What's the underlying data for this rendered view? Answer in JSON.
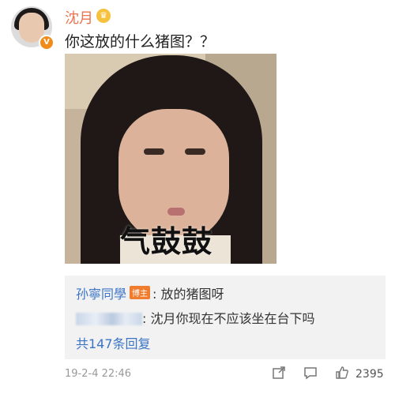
{
  "post": {
    "username": "沈月",
    "text": "你这放的什么猪图？？",
    "image": {
      "caption": "气鼓鼓"
    }
  },
  "comments": {
    "items": [
      {
        "user": "孙寧同學",
        "badge": "博主",
        "text": ": 放的猪图呀"
      },
      {
        "user_blurred": true,
        "text": ": 沈月你现在不应该坐在台下吗"
      }
    ],
    "more_replies": "共147条回复"
  },
  "footer": {
    "timestamp": "19-2-4 22:46",
    "like_count": "2395"
  },
  "colors": {
    "username": "#eb7350",
    "link": "#3b74c4",
    "badge": "#f07c2e",
    "comment_bg": "#f2f2f2"
  },
  "icons": [
    "verified-icon",
    "vip-crown-icon",
    "share-icon",
    "comment-icon",
    "like-icon"
  ]
}
